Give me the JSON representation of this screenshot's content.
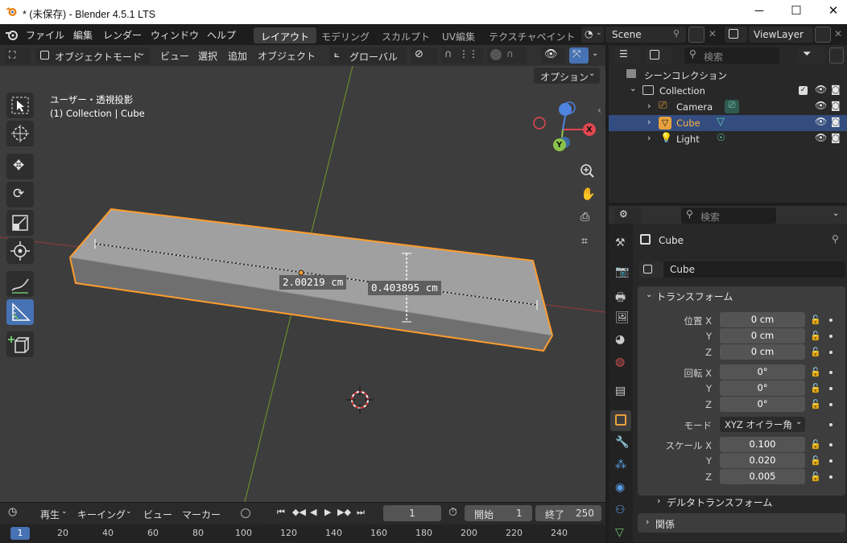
{
  "window": {
    "title": "* (未保存) - Blender 4.5.1 LTS",
    "minimize": "─",
    "maximize": "☐",
    "close": "✕"
  },
  "menu": {
    "items": [
      "ファイル",
      "編集",
      "レンダー",
      "ウィンドウ",
      "ヘルプ"
    ],
    "workspaces": [
      "レイアウト",
      "モデリング",
      "スカルプト",
      "UV編集",
      "テクスチャペイント"
    ],
    "active_workspace": "レイアウト",
    "scene": "Scene",
    "view_layer": "ViewLayer"
  },
  "viewport_header": {
    "mode": "オブジェクトモード",
    "menus": [
      "ビュー",
      "選択",
      "追加",
      "オブジェクト"
    ],
    "orientation": "グローバル",
    "options": "オプション"
  },
  "viewport": {
    "view_name": "ユーザー・透視投影",
    "collection_info": "(1) Collection | Cube",
    "measure_length": "2.00219 cm",
    "measure_height": "0.403895 cm",
    "gizmo": {
      "x": "X",
      "y": "Y"
    }
  },
  "timeline": {
    "playback": "再生",
    "keying": "キーイング",
    "view": "ビュー",
    "marker": "マーカー",
    "current_frame": "1",
    "start_label": "開始",
    "start": "1",
    "end_label": "終了",
    "end": "250",
    "ticks": [
      "1",
      "20",
      "40",
      "60",
      "80",
      "100",
      "120",
      "140",
      "160",
      "180",
      "200",
      "220",
      "240"
    ]
  },
  "outliner": {
    "search_placeholder": "検索",
    "root": "シーンコレクション",
    "collection": "Collection",
    "items": [
      {
        "name": "Camera"
      },
      {
        "name": "Cube",
        "selected": true
      },
      {
        "name": "Light"
      }
    ]
  },
  "properties": {
    "search_placeholder": "検索",
    "object_name": "Cube",
    "data_name": "Cube",
    "transform_title": "トランスフォーム",
    "location": {
      "label_x": "位置 X",
      "label_y": "Y",
      "label_z": "Z",
      "x": "0 cm",
      "y": "0 cm",
      "z": "0 cm"
    },
    "rotation": {
      "label_x": "回転 X",
      "label_y": "Y",
      "label_z": "Z",
      "x": "0°",
      "y": "0°",
      "z": "0°"
    },
    "mode_label": "モード",
    "mode_value": "XYZ オイラー角",
    "scale": {
      "label_x": "スケール X",
      "label_y": "Y",
      "label_z": "Z",
      "x": "0.100",
      "y": "0.020",
      "z": "0.005"
    },
    "delta_title": "デルタトランスフォーム",
    "relations_title": "関係"
  },
  "colors": {
    "accent": "#4772b3",
    "selection_orange": "#ff9d2e",
    "axis_x": "#e0474f",
    "axis_y": "#8bc34a",
    "axis_z": "#4e83e0"
  }
}
